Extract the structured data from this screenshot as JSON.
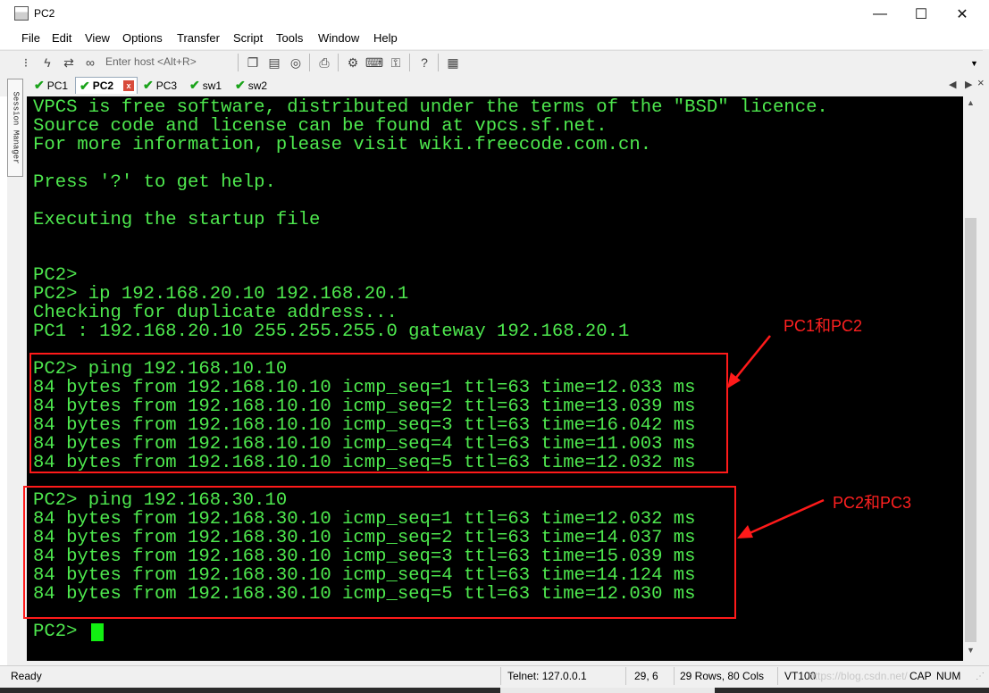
{
  "window": {
    "title": "PC2",
    "controls": {
      "minimize": "—",
      "maximize": "☐",
      "close": "✕"
    }
  },
  "menu": [
    "File",
    "Edit",
    "View",
    "Options",
    "Transfer",
    "Script",
    "Tools",
    "Window",
    "Help"
  ],
  "toolbar": {
    "host_placeholder": "Enter host <Alt+R>",
    "icons": [
      "connect-bar-icon",
      "quick-connect-icon",
      "reconnect-icon",
      "disconnect-link-icon",
      "copy-icon",
      "paste-icon",
      "find-icon",
      "print-icon",
      "settings-icon",
      "keymap-icon",
      "key-icon",
      "help-icon",
      "session-options-icon"
    ]
  },
  "side_panel": {
    "label": "Session Manager"
  },
  "tabs": [
    {
      "label": "PC1",
      "active": false
    },
    {
      "label": "PC2",
      "active": true
    },
    {
      "label": "PC3",
      "active": false
    },
    {
      "label": "sw1",
      "active": false
    },
    {
      "label": "sw2",
      "active": false
    }
  ],
  "tab_close": "x",
  "terminal": {
    "lines": [
      "VPCS is free software, distributed under the terms of the \"BSD\" licence.",
      "Source code and license can be found at vpcs.sf.net.",
      "For more information, please visit wiki.freecode.com.cn.",
      "",
      "Press '?' to get help.",
      "",
      "Executing the startup file",
      "",
      "",
      "PC2>",
      "PC2> ip 192.168.20.10 192.168.20.1",
      "Checking for duplicate address...",
      "PC1 : 192.168.20.10 255.255.255.0 gateway 192.168.20.1",
      "",
      "PC2> ping 192.168.10.10",
      "84 bytes from 192.168.10.10 icmp_seq=1 ttl=63 time=12.033 ms",
      "84 bytes from 192.168.10.10 icmp_seq=2 ttl=63 time=13.039 ms",
      "84 bytes from 192.168.10.10 icmp_seq=3 ttl=63 time=16.042 ms",
      "84 bytes from 192.168.10.10 icmp_seq=4 ttl=63 time=11.003 ms",
      "84 bytes from 192.168.10.10 icmp_seq=5 ttl=63 time=12.032 ms",
      "",
      "PC2> ping 192.168.30.10",
      "84 bytes from 192.168.30.10 icmp_seq=1 ttl=63 time=12.032 ms",
      "84 bytes from 192.168.30.10 icmp_seq=2 ttl=63 time=14.037 ms",
      "84 bytes from 192.168.30.10 icmp_seq=3 ttl=63 time=15.039 ms",
      "84 bytes from 192.168.30.10 icmp_seq=4 ttl=63 time=14.124 ms",
      "84 bytes from 192.168.30.10 icmp_seq=5 ttl=63 time=12.030 ms",
      "",
      "PC2> "
    ],
    "text_color": "#4ee84e",
    "background": "#000000"
  },
  "annotations": [
    {
      "label": "PC1和PC2"
    },
    {
      "label": "PC2和PC3"
    }
  ],
  "annotation_color": "#ff1a1a",
  "status": {
    "ready": "Ready",
    "connection": "Telnet: 127.0.0.1",
    "cursor_pos": "29,   6",
    "size": "29 Rows, 80 Cols",
    "emulation": "VT100",
    "watermark": "https://blog.csdn.net/",
    "caps": "CAP",
    "num": "NUM"
  }
}
